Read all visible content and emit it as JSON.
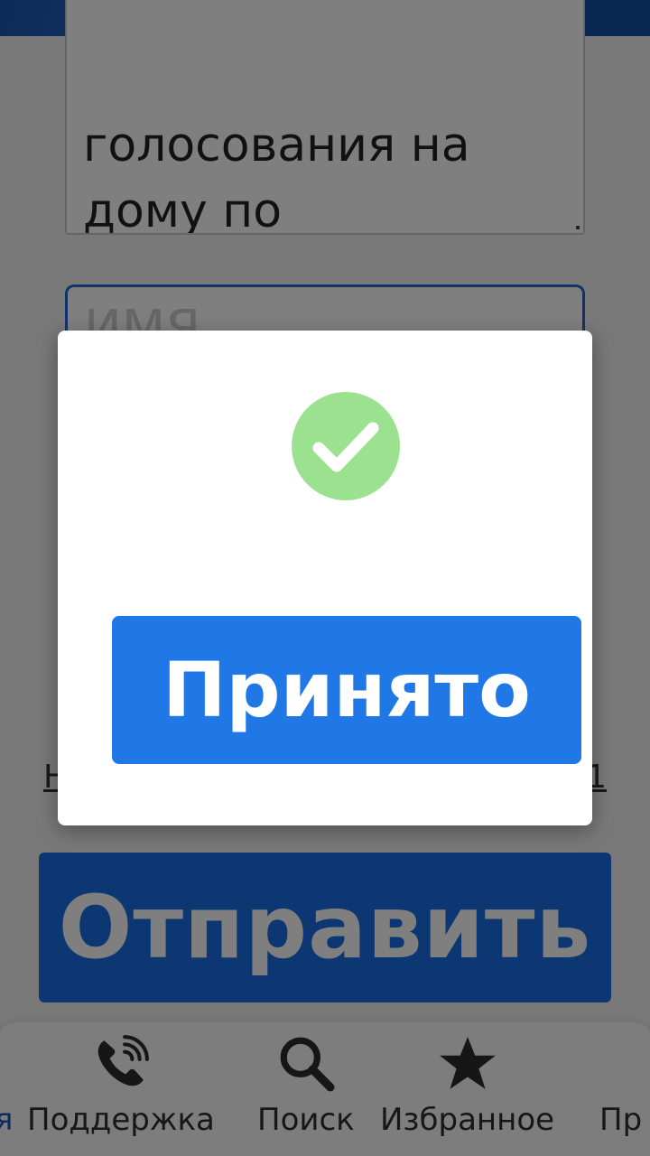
{
  "header": {
    "bg_color": "#1a56b0"
  },
  "form": {
    "comment_text": "голосования на\nдому по\nзаявлениям.",
    "name_placeholder": "ИМЯ",
    "consent_left": "Н",
    "consent_right": "1",
    "submit_label": "Отправить"
  },
  "modal": {
    "icon": "success-check-icon",
    "icon_color": "#9ce18f",
    "accept_label": "Принято"
  },
  "bottom_nav": {
    "edge_left_label": "я",
    "edge_right_label": "Пр",
    "items": [
      {
        "label": "Поддержка",
        "icon": "phone-icon"
      },
      {
        "label": "Поиск",
        "icon": "search-icon"
      },
      {
        "label": "Избранное",
        "icon": "star-icon"
      }
    ]
  }
}
